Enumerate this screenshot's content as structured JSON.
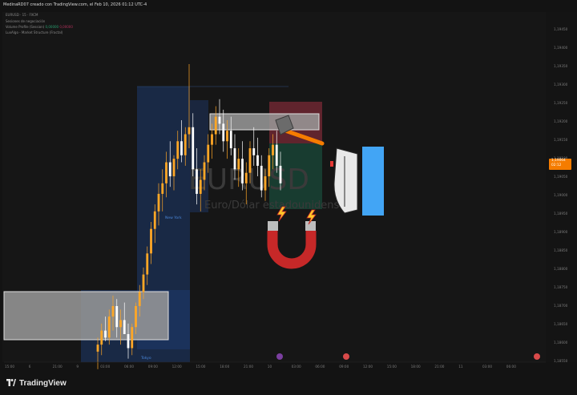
{
  "header": {
    "credit": "MedinaRD07 creado con TradingView.com, el Feb 10, 2026 01:12 UTC-4",
    "symbol_line": "EURUSD · 15 · FXCM",
    "indicators": [
      {
        "name": "Sesiones de negociación",
        "values": []
      },
      {
        "name": "Volume Profile (Session)",
        "values": [
          "0,00000",
          "0,00000"
        ]
      },
      {
        "name": "LuxAlgo - Market Structure (Fractal)",
        "values": []
      }
    ]
  },
  "watermark": {
    "symbol": "EURUSD",
    "description": "Euro/Dólar estadounidense"
  },
  "sessions": {
    "new_york": "New York",
    "tokyo": "Tokyo"
  },
  "price_axis": {
    "ticks": [
      "1,19450",
      "1,19400",
      "1,19350",
      "1,19300",
      "1,19250",
      "1,19200",
      "1,19150",
      "1,19100",
      "1,19050",
      "1,19000",
      "1,18950",
      "1,18900",
      "1,18850",
      "1,18800",
      "1,18750",
      "1,18700",
      "1,18650",
      "1,18600",
      "1,18550"
    ],
    "current_price": "1,19064",
    "countdown": "02:12"
  },
  "time_axis": {
    "ticks": [
      "15:00",
      "6",
      "21:00",
      "9",
      "03:00",
      "06:00",
      "09:00",
      "12:00",
      "15:00",
      "18:00",
      "21:00",
      "10",
      "03:00",
      "06:00",
      "09:00",
      "12:00",
      "15:00",
      "18:00",
      "21:00",
      "11",
      "03:00",
      "06:00"
    ]
  },
  "footer": {
    "brand": "TradingView"
  },
  "colors": {
    "bull": "#ffa726",
    "bear": "#ffffff",
    "session_fill": "#1e3a6e",
    "supply_fill": "#7a2a35",
    "demand_fill": "#1a4a3a",
    "price_tag": "#f57c00"
  },
  "stickers": [
    "hammer",
    "ship",
    "magnet",
    "lightning",
    "lightning"
  ],
  "chart_data": {
    "type": "candlestick",
    "symbol": "EURUSD",
    "timeframe": "15",
    "ylim": [
      1.1855,
      1.1948
    ],
    "candles": [
      [
        1.1858,
        1.1862,
        1.1853,
        1.186
      ],
      [
        1.186,
        1.1866,
        1.1857,
        1.1864
      ],
      [
        1.1864,
        1.1868,
        1.1861,
        1.1862
      ],
      [
        1.1862,
        1.187,
        1.186,
        1.1868
      ],
      [
        1.1868,
        1.1874,
        1.1864,
        1.1871
      ],
      [
        1.1871,
        1.1873,
        1.1862,
        1.1865
      ],
      [
        1.1865,
        1.187,
        1.186,
        1.1867
      ],
      [
        1.1867,
        1.1872,
        1.1863,
        1.1863
      ],
      [
        1.1863,
        1.1866,
        1.1856,
        1.1859
      ],
      [
        1.1859,
        1.1866,
        1.1857,
        1.1865
      ],
      [
        1.1865,
        1.1872,
        1.1863,
        1.1871
      ],
      [
        1.1871,
        1.1877,
        1.1868,
        1.1875
      ],
      [
        1.1875,
        1.1882,
        1.1873,
        1.188
      ],
      [
        1.188,
        1.1888,
        1.1877,
        1.1886
      ],
      [
        1.1886,
        1.1895,
        1.1883,
        1.1893
      ],
      [
        1.1893,
        1.19,
        1.1889,
        1.1898
      ],
      [
        1.1898,
        1.1906,
        1.1894,
        1.1903
      ],
      [
        1.1903,
        1.191,
        1.1898,
        1.1906
      ],
      [
        1.1906,
        1.1915,
        1.1902,
        1.1912
      ],
      [
        1.1912,
        1.1918,
        1.1905,
        1.1908
      ],
      [
        1.1908,
        1.1914,
        1.1904,
        1.1913
      ],
      [
        1.1913,
        1.1921,
        1.191,
        1.1918
      ],
      [
        1.1918,
        1.1924,
        1.1912,
        1.1914
      ],
      [
        1.1914,
        1.1922,
        1.1911,
        1.192
      ],
      [
        1.192,
        1.194,
        1.1916,
        1.1922
      ],
      [
        1.1922,
        1.1926,
        1.1908,
        1.191
      ],
      [
        1.191,
        1.1916,
        1.19,
        1.1903
      ],
      [
        1.1903,
        1.191,
        1.1898,
        1.1907
      ],
      [
        1.1907,
        1.1914,
        1.1904,
        1.1912
      ],
      [
        1.1912,
        1.192,
        1.1909,
        1.1917
      ],
      [
        1.1917,
        1.1923,
        1.1913,
        1.192
      ],
      [
        1.192,
        1.1928,
        1.1917,
        1.1925
      ],
      [
        1.1925,
        1.193,
        1.192,
        1.1923
      ],
      [
        1.1923,
        1.1927,
        1.1915,
        1.1918
      ],
      [
        1.1918,
        1.1924,
        1.1913,
        1.1921
      ],
      [
        1.1921,
        1.1925,
        1.1914,
        1.1916
      ],
      [
        1.1916,
        1.192,
        1.1907,
        1.191
      ],
      [
        1.191,
        1.1916,
        1.1905,
        1.1913
      ],
      [
        1.1913,
        1.1918,
        1.1904,
        1.1906
      ],
      [
        1.1906,
        1.1912,
        1.19,
        1.1909
      ],
      [
        1.1909,
        1.1918,
        1.1906,
        1.1916
      ],
      [
        1.1916,
        1.1922,
        1.1911,
        1.1914
      ],
      [
        1.1914,
        1.1919,
        1.1908,
        1.1911
      ],
      [
        1.1911,
        1.1914,
        1.1902,
        1.1904
      ],
      [
        1.1904,
        1.191,
        1.1901,
        1.1908
      ],
      [
        1.1908,
        1.1916,
        1.1905,
        1.1914
      ],
      [
        1.1914,
        1.192,
        1.191,
        1.1917
      ],
      [
        1.1917,
        1.1921,
        1.1909,
        1.1911
      ],
      [
        1.1911,
        1.1915,
        1.1904,
        1.1906
      ]
    ]
  }
}
